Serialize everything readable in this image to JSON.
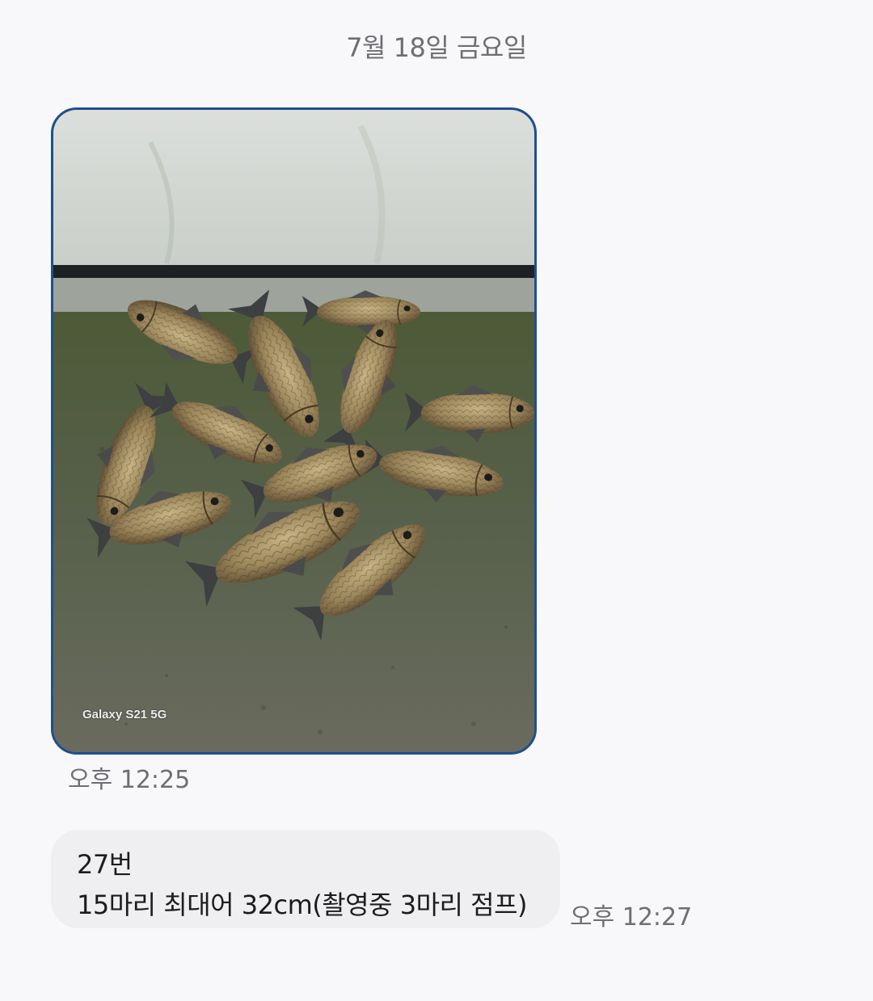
{
  "date_header": "7월 18일 금요일",
  "messages": [
    {
      "type": "image",
      "image_description": "photo of caught crucian carp on wet concrete",
      "watermark": "Galaxy S21 5G",
      "time": "오후 12:25"
    },
    {
      "type": "text",
      "lines": [
        "27번",
        "15마리 최대어 32cm(촬영중 3마리 점프)"
      ],
      "time": "오후 12:27"
    }
  ],
  "colors": {
    "background": "#f8f8fa",
    "bubble_border": "#1f4f91",
    "text_bubble_bg": "#efeff1",
    "timestamp": "#6e6e73"
  }
}
